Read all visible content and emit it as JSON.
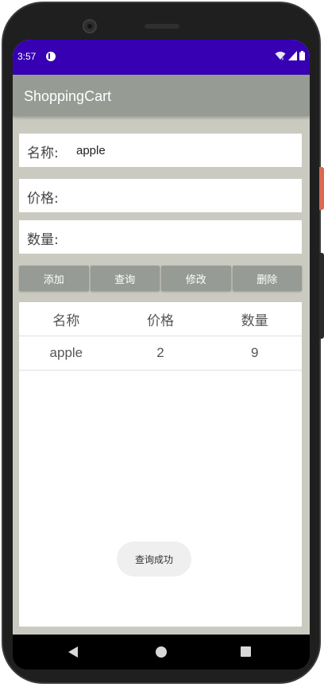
{
  "status_bar": {
    "time": "3:57",
    "icons": [
      "app-notification-icon",
      "wifi-icon",
      "signal-icon",
      "battery-icon"
    ],
    "background_color": "#3700b3"
  },
  "app_bar": {
    "title": "ShoppingCart",
    "background_color": "#969b93"
  },
  "form": {
    "name_label": "名称:",
    "name_value": "apple",
    "price_label": "价格:",
    "price_value": "",
    "quantity_label": "数量:",
    "quantity_value": ""
  },
  "actions": {
    "add_label": "添加",
    "query_label": "查询",
    "modify_label": "修改",
    "delete_label": "删除"
  },
  "table": {
    "headers": [
      "名称",
      "价格",
      "数量"
    ],
    "rows": [
      [
        "apple",
        "2",
        "9"
      ]
    ]
  },
  "toast": {
    "message": "查询成功"
  },
  "nav": {
    "icons": [
      "back-icon",
      "home-icon",
      "recents-icon"
    ]
  }
}
